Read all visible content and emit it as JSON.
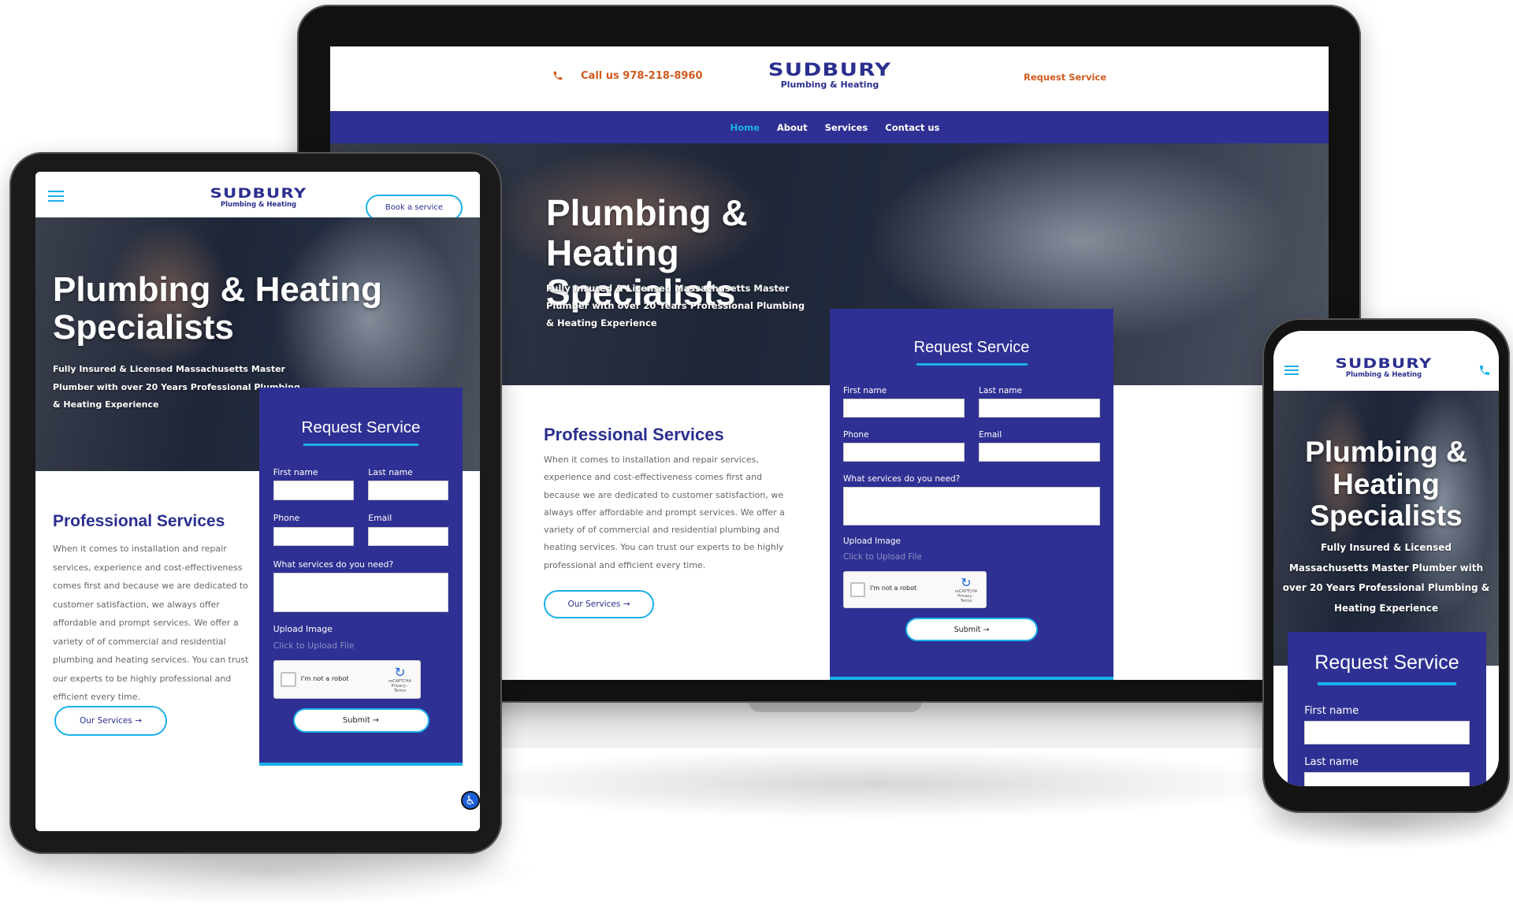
{
  "site": {
    "phone_label": "Call us 978-218-8960",
    "logo_main": "SUDBURY",
    "logo_sub": "Plumbing & Heating",
    "request_service_link": "Request Service",
    "book_service_button": "Book a service",
    "nav": [
      {
        "label": "Home",
        "active": true
      },
      {
        "label": "About"
      },
      {
        "label": "Services"
      },
      {
        "label": "Contact us"
      }
    ],
    "hero_title": "Plumbing & Heating Specialists",
    "hero_subtitle": "Fully Insured & Licensed Massachusetts Master Plumber with over 20 Years Professional Plumbing & Heating Experience",
    "services_title": "Professional Services",
    "services_text": "When it comes to installation and repair services, experience and cost-effectiveness comes first and because we are dedicated to customer satisfaction, we always offer affordable and prompt services. We offer a variety of of commercial and residential plumbing and heating services. You can trust our experts to be highly professional and efficient every time.",
    "services_button": "Our Services →"
  },
  "form": {
    "title": "Request Service",
    "first_name": "First name",
    "last_name": "Last name",
    "phone": "Phone",
    "email": "Email",
    "services_question": "What services do you need?",
    "upload_label": "Upload Image",
    "upload_link": "Click to Upload File",
    "captcha_label": "I'm not a robot",
    "captcha_brand": "reCAPTCHA",
    "captcha_links": "Privacy - Terms",
    "submit": "Submit →"
  },
  "colors": {
    "brand_blue": "#2e3093",
    "accent_cyan": "#1ab0ea",
    "orange": "#d05a1e"
  },
  "icons": [
    "phone-icon",
    "hamburger-menu-icon",
    "accessibility-icon",
    "recaptcha-icon"
  ]
}
